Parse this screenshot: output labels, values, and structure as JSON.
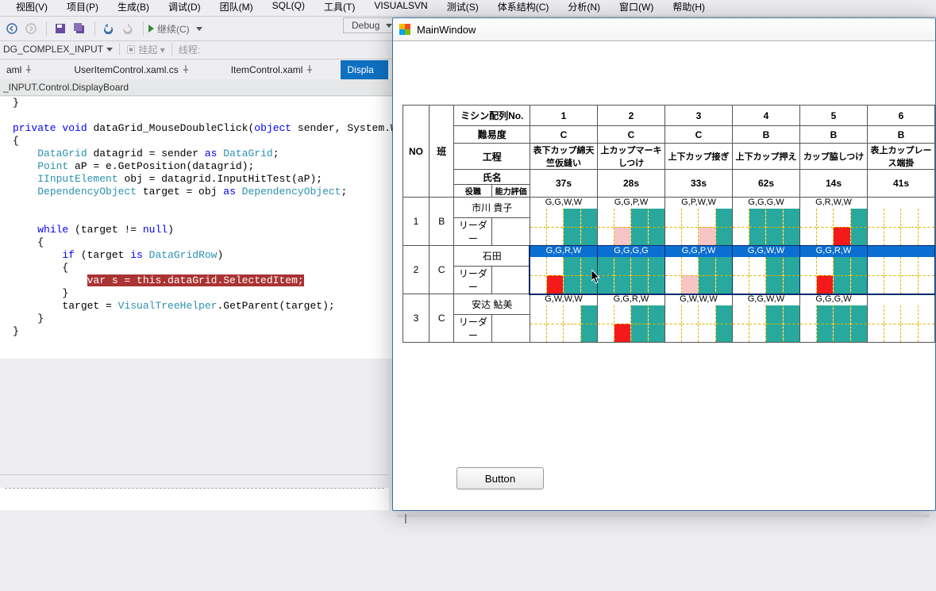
{
  "vs": {
    "menu": [
      "视图(V)",
      "项目(P)",
      "生成(B)",
      "调试(D)",
      "团队(M)",
      "SQL(Q)",
      "工具(T)",
      "VISUALSVN",
      "测试(S)",
      "体系结构(C)",
      "分析(N)",
      "窗口(W)",
      "帮助(H)"
    ],
    "continue": "继续(C)",
    "debug_dropdown": "Debug",
    "process_combo": "DG_COMPLEX_INPUT",
    "suspend": "挂起",
    "thread_label": "线程:",
    "tabs": [
      {
        "label": "aml",
        "active": false
      },
      {
        "label": "UserItemControl.xaml.cs",
        "active": false
      },
      {
        "label": "ItemControl.xaml",
        "active": false
      },
      {
        "label": "Displa",
        "active": true
      }
    ],
    "breadcrumb": "_INPUT.Control.DisplayBoard",
    "code": {
      "l01": "}",
      "l02": "",
      "l03a": "private",
      "l03b": "void",
      "l03c": "dataGrid_MouseDoubleClick(",
      "l03d": "object",
      "l03e": " sender, System.Windo",
      "l04": "{",
      "l05a": "DataGrid",
      "l05b": " datagrid = sender ",
      "l05c": "as",
      "l05d": " DataGrid",
      "l05e": ";",
      "l06a": "Point",
      "l06b": " aP = e.GetPosition(datagrid);",
      "l07a": "IInputElement",
      "l07b": " obj = datagrid.InputHitTest(aP);",
      "l08a": "DependencyObject",
      "l08b": " target = obj ",
      "l08c": "as",
      "l08d": " DependencyObject",
      "l08e": ";",
      "l09": "",
      "l10a": "while",
      "l10b": " (target != ",
      "l10c": "null",
      "l10d": ")",
      "l11": "{",
      "l12a": "if",
      "l12b": " (target ",
      "l12c": "is",
      "l12d": " DataGridRow",
      "l12e": ")",
      "l13": "{",
      "l14": "var s = this.dataGrid.SelectedItem;",
      "l15": "}",
      "l16a": "target = ",
      "l16b": "VisualTreeHelper",
      "l16c": ".GetParent(target);",
      "l17": "}",
      "l18": "}"
    }
  },
  "app": {
    "title": "MainWindow",
    "button": "Button",
    "headers": {
      "mishin": "ミシン配列No.",
      "nanido": "難易度",
      "kotei": "工程",
      "no": "NO",
      "han": "班",
      "shimei": "氏名",
      "yakushoku": "役職",
      "noryoku": "能力評価"
    },
    "cols": [
      {
        "no": "1",
        "diff": "C",
        "proc": "表下カップ綿天竺仮縫い",
        "time": "37s"
      },
      {
        "no": "2",
        "diff": "C",
        "proc": "上カップマーキしつけ",
        "time": "28s"
      },
      {
        "no": "3",
        "diff": "C",
        "proc": "上下カップ接ぎ",
        "time": "33s"
      },
      {
        "no": "4",
        "diff": "B",
        "proc": "上下カップ押え",
        "time": "62s"
      },
      {
        "no": "5",
        "diff": "B",
        "proc": "カップ脇しつけ",
        "time": "14s"
      },
      {
        "no": "6",
        "diff": "B",
        "proc": "表上カップレース端掛",
        "time": "41s"
      }
    ],
    "rows": [
      {
        "no": "1",
        "han": "B",
        "name": "市川 貴子",
        "role": "リーダー",
        "cells": [
          {
            "label": "G,G,W,W",
            "blocks": [
              "W",
              "W",
              "T",
              "T"
            ]
          },
          {
            "label": "G,G,P,W",
            "blocks": [
              "W",
              "P",
              "T",
              "T"
            ]
          },
          {
            "label": "G,P,W,W",
            "blocks": [
              "W",
              "W",
              "P",
              "T"
            ]
          },
          {
            "label": "G,G,G,W",
            "blocks": [
              "W",
              "T",
              "T",
              "T"
            ]
          },
          {
            "label": "G,R,W,W",
            "blocks": [
              "W",
              "W",
              "R",
              "T"
            ]
          },
          {
            "label": "",
            "blocks": [
              "W",
              "W",
              "W",
              "W"
            ]
          }
        ]
      },
      {
        "no": "2",
        "han": "C",
        "name": "石田",
        "role": "リーダー",
        "selected": true,
        "cells": [
          {
            "label": "G,G,R,W",
            "blocks": [
              "W",
              "R",
              "T",
              "T"
            ]
          },
          {
            "label": "G,G,G,G",
            "blocks": [
              "T",
              "T",
              "T",
              "T"
            ]
          },
          {
            "label": "G,G,P,W",
            "blocks": [
              "W",
              "P",
              "T",
              "T"
            ]
          },
          {
            "label": "G,G,W,W",
            "blocks": [
              "W",
              "W",
              "T",
              "T"
            ]
          },
          {
            "label": "G,G,R,W",
            "blocks": [
              "W",
              "R",
              "T",
              "T"
            ]
          },
          {
            "label": "",
            "blocks": [
              "W",
              "W",
              "W",
              "W"
            ]
          }
        ]
      },
      {
        "no": "3",
        "han": "C",
        "name": "安达 鮎美",
        "role": "リーダー",
        "cells": [
          {
            "label": "G,W,W,W",
            "blocks": [
              "W",
              "W",
              "W",
              "T"
            ]
          },
          {
            "label": "G,G,R,W",
            "blocks": [
              "W",
              "R",
              "T",
              "T"
            ]
          },
          {
            "label": "G,W,W,W",
            "blocks": [
              "W",
              "W",
              "W",
              "T"
            ]
          },
          {
            "label": "G,G,W,W",
            "blocks": [
              "W",
              "W",
              "T",
              "T"
            ]
          },
          {
            "label": "G,G,G,W",
            "blocks": [
              "W",
              "T",
              "T",
              "T"
            ]
          },
          {
            "label": "",
            "blocks": [
              "W",
              "W",
              "W",
              "W"
            ]
          }
        ]
      }
    ]
  }
}
